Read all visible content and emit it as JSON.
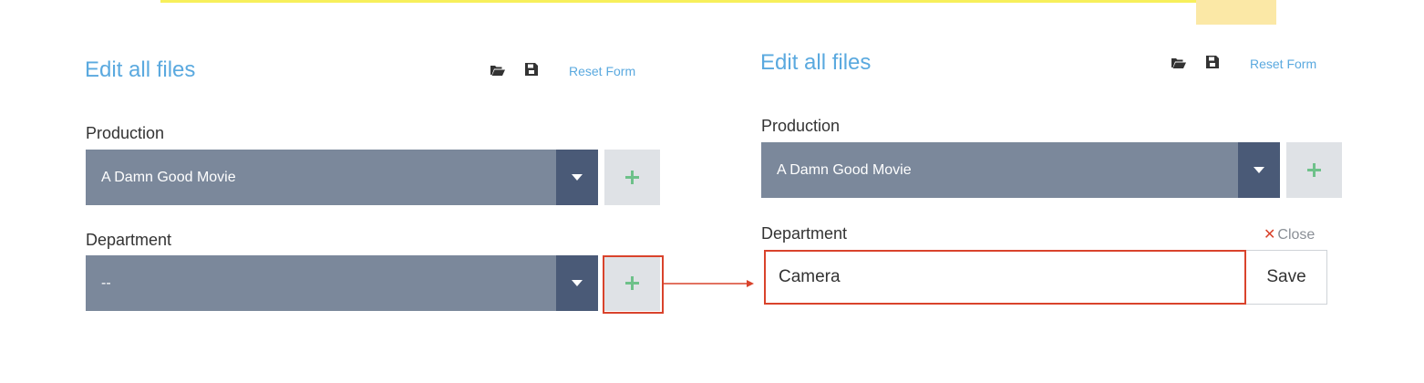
{
  "left_panel": {
    "title": "Edit all files",
    "reset_label": "Reset Form",
    "production": {
      "label": "Production",
      "value": "A Damn Good Movie"
    },
    "department": {
      "label": "Department",
      "value": "--"
    }
  },
  "right_panel": {
    "title": "Edit all files",
    "reset_label": "Reset Form",
    "production": {
      "label": "Production",
      "value": "A Damn Good Movie"
    },
    "department": {
      "label": "Department",
      "close_label": "Close",
      "input_value": "Camera",
      "save_label": "Save"
    }
  },
  "icons": {
    "open": "folder-open-icon",
    "save": "floppy-disk-icon",
    "dropdown": "caret-down-icon",
    "add": "plus-icon",
    "close": "x-icon"
  },
  "colors": {
    "accent": "#5aa9df",
    "select_bg": "#7b889b",
    "select_caret": "#4a5a77",
    "add_btn_bg": "#dfe2e6",
    "plus": "#6ec18a",
    "annotation_red": "#d9432c",
    "banner": "#f7ef5b"
  }
}
